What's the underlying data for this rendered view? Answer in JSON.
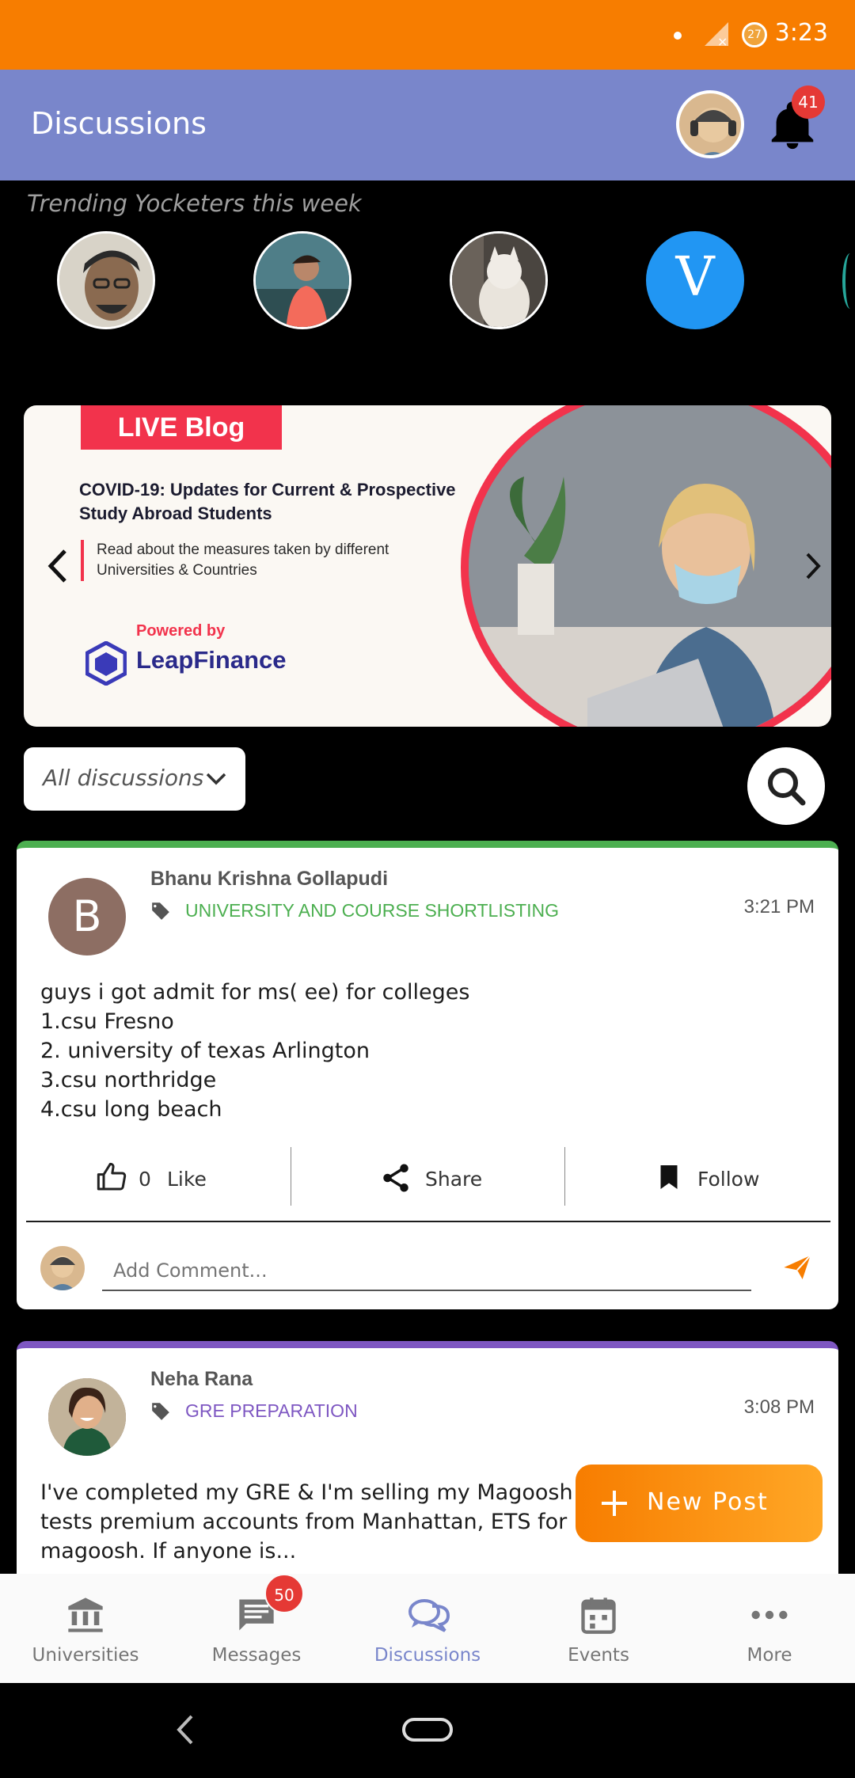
{
  "status_bar": {
    "time": "3:23",
    "notification_count": "27"
  },
  "header": {
    "title": "Discussions",
    "notification_badge": "41"
  },
  "trending": {
    "label": "Trending Yocketers this week",
    "letter_avatar": "V"
  },
  "banner": {
    "badge": "LIVE Blog",
    "heading": "COVID-19: Updates for Current & Prospective Study Abroad Students",
    "subtext": "Read about the measures taken by different Universities & Countries",
    "powered_by": "Powered by",
    "brand": "LeapFinance"
  },
  "filter": {
    "selected": "All discussions"
  },
  "posts": [
    {
      "avatar_letter": "B",
      "author": "Bhanu Krishna Gollapudi",
      "tag": "UNIVERSITY AND COURSE SHORTLISTING",
      "tag_color": "#4caf50",
      "time": "3:21 PM",
      "body": "guys i got admit for ms( ee) for colleges\n1.csu Fresno\n2. university of texas Arlington\n3.csu northridge\n4.csu long beach",
      "like_count": "0",
      "like_label": "Like",
      "share_label": "Share",
      "follow_label": "Follow",
      "comment_placeholder": "Add Comment..."
    },
    {
      "author": "Neha Rana",
      "tag": "GRE PREPARATION",
      "tag_color": "#7e57c2",
      "time": "3:08 PM",
      "body": "I've completed my GRE & I'm selling my Magoosh GRE. I also provide 18 tests premium accounts from Manhattan, ETS for FREE along with magoosh. If anyone is..."
    }
  ],
  "fab": {
    "label": "New Post"
  },
  "bottom_nav": {
    "items": [
      {
        "label": "Universities"
      },
      {
        "label": "Messages",
        "badge": "50"
      },
      {
        "label": "Discussions"
      },
      {
        "label": "Events"
      },
      {
        "label": "More"
      }
    ]
  },
  "colors": {
    "accent": "#f77d00",
    "header": "#7986cb"
  }
}
